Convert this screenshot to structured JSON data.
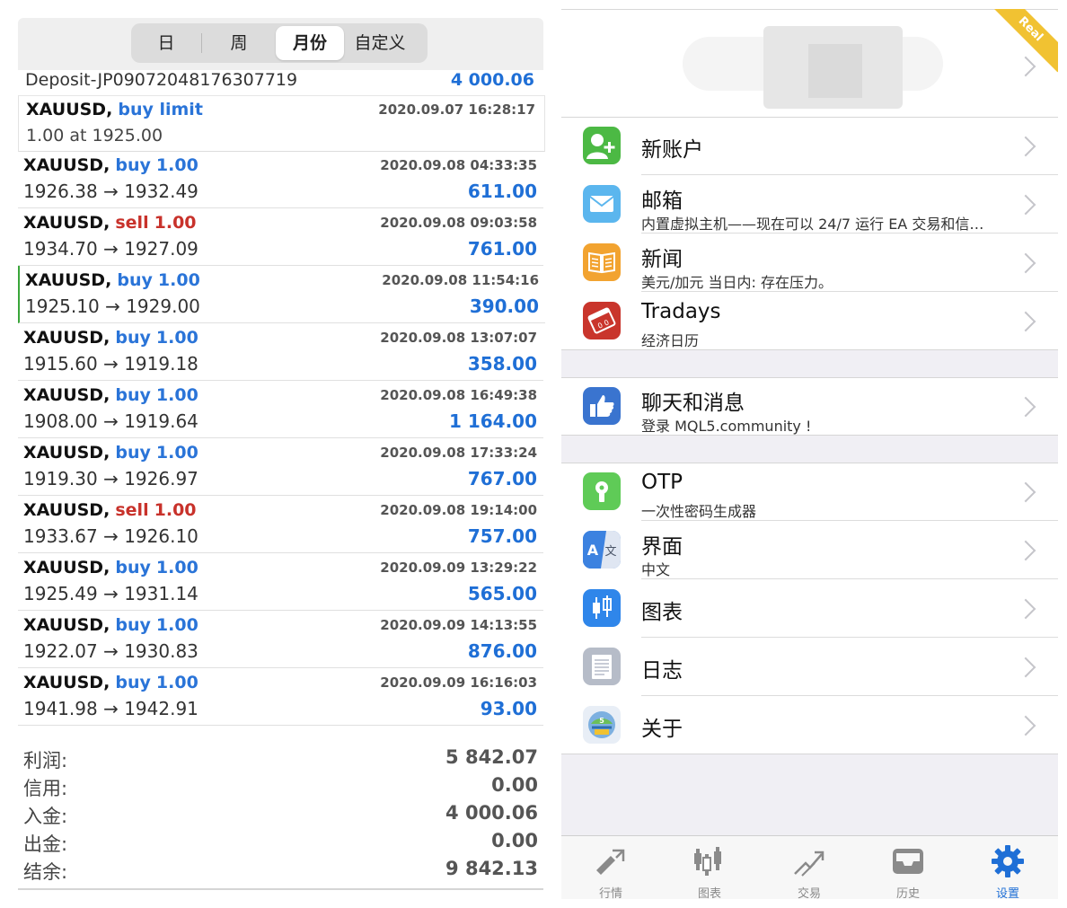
{
  "history": {
    "segments": [
      "日",
      "周",
      "月份",
      "自定义"
    ],
    "active_segment": "月份",
    "deposit": {
      "label": "Deposit-JP09072048176307719",
      "amount": "4 000.06"
    },
    "pending": {
      "symbol": "XAUUSD,",
      "type": "buy limit",
      "time": "2020.09.07 16:28:17",
      "detail": "1.00 at 1925.00"
    },
    "trades": [
      {
        "symbol": "XAUUSD,",
        "side": "buy",
        "volume": "1.00",
        "time": "2020.09.08 04:33:35",
        "open": "1926.38",
        "close": "1932.49",
        "profit": "611.00"
      },
      {
        "symbol": "XAUUSD,",
        "side": "sell",
        "volume": "1.00",
        "time": "2020.09.08 09:03:58",
        "open": "1934.70",
        "close": "1927.09",
        "profit": "761.00"
      },
      {
        "symbol": "XAUUSD,",
        "side": "buy",
        "volume": "1.00",
        "time": "2020.09.08 11:54:16",
        "open": "1925.10",
        "close": "1929.00",
        "profit": "390.00"
      },
      {
        "symbol": "XAUUSD,",
        "side": "buy",
        "volume": "1.00",
        "time": "2020.09.08 13:07:07",
        "open": "1915.60",
        "close": "1919.18",
        "profit": "358.00"
      },
      {
        "symbol": "XAUUSD,",
        "side": "buy",
        "volume": "1.00",
        "time": "2020.09.08 16:49:38",
        "open": "1908.00",
        "close": "1919.64",
        "profit": "1 164.00"
      },
      {
        "symbol": "XAUUSD,",
        "side": "buy",
        "volume": "1.00",
        "time": "2020.09.08 17:33:24",
        "open": "1919.30",
        "close": "1926.97",
        "profit": "767.00"
      },
      {
        "symbol": "XAUUSD,",
        "side": "sell",
        "volume": "1.00",
        "time": "2020.09.08 19:14:00",
        "open": "1933.67",
        "close": "1926.10",
        "profit": "757.00"
      },
      {
        "symbol": "XAUUSD,",
        "side": "buy",
        "volume": "1.00",
        "time": "2020.09.09 13:29:22",
        "open": "1925.49",
        "close": "1931.14",
        "profit": "565.00"
      },
      {
        "symbol": "XAUUSD,",
        "side": "buy",
        "volume": "1.00",
        "time": "2020.09.09 14:13:55",
        "open": "1922.07",
        "close": "1930.83",
        "profit": "876.00"
      },
      {
        "symbol": "XAUUSD,",
        "side": "buy",
        "volume": "1.00",
        "time": "2020.09.09 16:16:03",
        "open": "1941.98",
        "close": "1942.91",
        "profit": "93.00"
      }
    ],
    "summary": [
      {
        "label": "利润:",
        "value": "5 842.07"
      },
      {
        "label": "信用:",
        "value": "0.00"
      },
      {
        "label": "入金:",
        "value": "4 000.06"
      },
      {
        "label": "出金:",
        "value": "0.00"
      },
      {
        "label": "结余:",
        "value": "9 842.13"
      }
    ]
  },
  "settings": {
    "account_badge": "Real",
    "groups": [
      [
        {
          "title": "新账户",
          "subtitle": "",
          "icon": "add-user-icon",
          "color": "#4cb944"
        },
        {
          "title": "邮箱",
          "subtitle": "内置虚拟主机——现在可以 24/7 运行 EA 交易和信…",
          "icon": "mail-icon",
          "color": "#5bb6ee"
        },
        {
          "title": "新闻",
          "subtitle": "美元/加元 当日内: 存在压力。",
          "icon": "book-icon",
          "color": "#f2a330"
        },
        {
          "title": "Tradays",
          "subtitle": "经济日历",
          "icon": "calendar-icon",
          "color": "#c9352c"
        }
      ],
      [
        {
          "title": "聊天和消息",
          "subtitle": "登录 MQL5.community !",
          "icon": "thumbs-up-icon",
          "color": "#3a74cf"
        }
      ],
      [
        {
          "title": "OTP",
          "subtitle": "一次性密码生成器",
          "icon": "keyhole-icon",
          "color": "#5fcb57"
        },
        {
          "title": "界面",
          "subtitle": "中文",
          "icon": "translate-icon",
          "color": "#3c82e0"
        },
        {
          "title": "图表",
          "subtitle": "",
          "icon": "candlestick-icon",
          "color": "#2f86ea"
        },
        {
          "title": "日志",
          "subtitle": "",
          "icon": "journal-icon",
          "color": "#b6bcc8"
        },
        {
          "title": "关于",
          "subtitle": "",
          "icon": "metatrader-logo-icon",
          "color": "#e8eef6"
        }
      ]
    ]
  },
  "tabbar": {
    "items": [
      {
        "label": "行情",
        "icon": "quotes-icon"
      },
      {
        "label": "图表",
        "icon": "chart-icon"
      },
      {
        "label": "交易",
        "icon": "trade-icon"
      },
      {
        "label": "历史",
        "icon": "history-icon"
      },
      {
        "label": "设置",
        "icon": "settings-gear-icon"
      }
    ],
    "active": "设置",
    "active_color": "#1f6fd6",
    "inactive_color": "#8a8a8a"
  }
}
